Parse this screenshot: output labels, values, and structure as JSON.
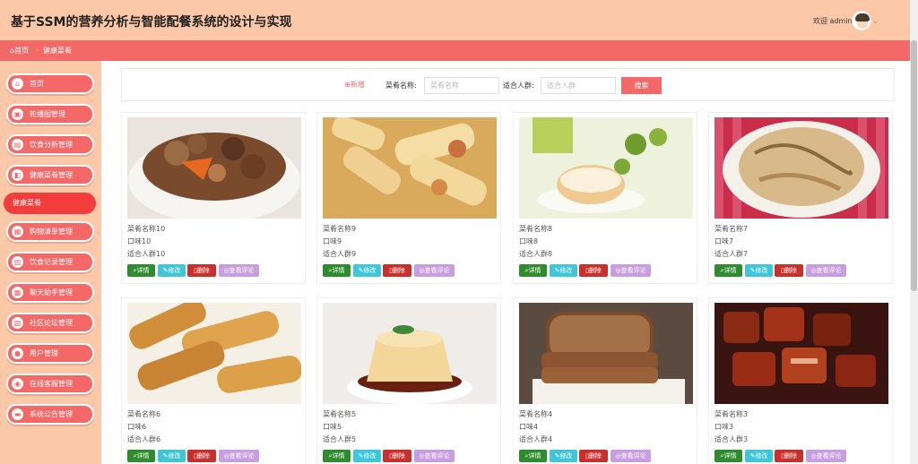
{
  "header": {
    "title": "基于SSM的营养分析与智能配餐系统的设计与实现",
    "welcome": "欢迎 admin",
    "caret": "⌵"
  },
  "breadcrumb": {
    "home": "首页",
    "separator": "-",
    "current": "健康菜肴"
  },
  "sidebar": {
    "items": [
      {
        "label": "首页",
        "icon": "home-icon"
      },
      {
        "label": "轮播图管理",
        "icon": "image-icon"
      },
      {
        "label": "饮食分析管理",
        "icon": "chart-icon"
      },
      {
        "label": "健康菜肴管理",
        "icon": "dish-icon"
      },
      {
        "label": "购物清单管理",
        "icon": "cart-icon"
      },
      {
        "label": "饮食记录管理",
        "icon": "record-icon"
      },
      {
        "label": "聊天助手管理",
        "icon": "chat-icon"
      },
      {
        "label": "社区论坛管理",
        "icon": "forum-icon"
      },
      {
        "label": "用户管理",
        "icon": "user-icon"
      },
      {
        "label": "在线客服管理",
        "icon": "service-icon"
      },
      {
        "label": "系统公告管理",
        "icon": "notice-icon"
      }
    ],
    "active_sub": "健康菜肴"
  },
  "search": {
    "add_label": "新增",
    "name_label": "菜肴名称:",
    "name_placeholder": "菜肴名称",
    "crowd_label": "适合人群:",
    "crowd_placeholder": "适合人群",
    "button_label": "搜索"
  },
  "actions": {
    "detail": "详情",
    "edit": "修改",
    "delete": "删除",
    "comment": "查看评论"
  },
  "cards": [
    {
      "name": "菜肴名称10",
      "taste": "口味10",
      "crowd": "适合人群10",
      "image": "chestnut-stew"
    },
    {
      "name": "菜肴名称9",
      "taste": "口味9",
      "crowd": "适合人群9",
      "image": "spring-rolls"
    },
    {
      "name": "菜肴名称8",
      "taste": "口味8",
      "crowd": "适合人群8",
      "image": "cream-puff"
    },
    {
      "name": "菜肴名称7",
      "taste": "口味7",
      "crowd": "适合人群7",
      "image": "fried-noodles"
    },
    {
      "name": "菜肴名称6",
      "taste": "口味6",
      "crowd": "适合人群6",
      "image": "fried-rolls"
    },
    {
      "name": "菜肴名称5",
      "taste": "口味5",
      "crowd": "适合人群5",
      "image": "pudding"
    },
    {
      "name": "菜肴名称4",
      "taste": "口味4",
      "crowd": "适合人群4",
      "image": "bread-slices"
    },
    {
      "name": "菜肴名称3",
      "taste": "口味3",
      "crowd": "适合人群3",
      "image": "braised-pork"
    }
  ],
  "colors": {
    "header_bg": "#fdc8a8",
    "accent": "#f46868",
    "active": "#f33d3d"
  }
}
